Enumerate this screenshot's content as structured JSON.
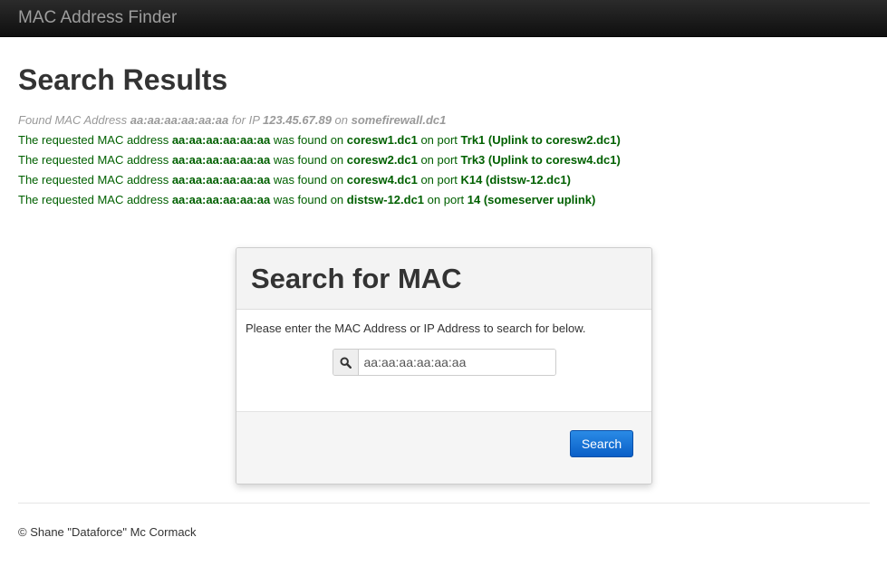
{
  "navbar": {
    "brand": "MAC Address Finder"
  },
  "results": {
    "title": "Search Results",
    "summary": {
      "prefix": "Found MAC Address ",
      "mac": "aa:aa:aa:aa:aa:aa",
      "for_ip": " for IP ",
      "ip": "123.45.67.89",
      "on": " on ",
      "device": "somefirewall.dc1"
    },
    "lines": [
      {
        "prefix": "The requested MAC address ",
        "mac": "aa:aa:aa:aa:aa:aa",
        "found_on": " was found on ",
        "switch": "coresw1.dc1",
        "on_port": " on port ",
        "port": "Trk1 (Uplink to coresw2.dc1)"
      },
      {
        "prefix": "The requested MAC address ",
        "mac": "aa:aa:aa:aa:aa:aa",
        "found_on": " was found on ",
        "switch": "coresw2.dc1",
        "on_port": " on port ",
        "port": "Trk3 (Uplink to coresw4.dc1)"
      },
      {
        "prefix": "The requested MAC address ",
        "mac": "aa:aa:aa:aa:aa:aa",
        "found_on": " was found on ",
        "switch": "coresw4.dc1",
        "on_port": " on port ",
        "port": "K14 (distsw-12.dc1)"
      },
      {
        "prefix": "The requested MAC address ",
        "mac": "aa:aa:aa:aa:aa:aa",
        "found_on": " was found on ",
        "switch": "distsw-12.dc1",
        "on_port": " on port ",
        "port": "14 (someserver uplink)"
      }
    ]
  },
  "search_panel": {
    "title": "Search for MAC",
    "hint": "Please enter the MAC Address or IP Address to search for below.",
    "input_value": "aa:aa:aa:aa:aa:aa",
    "search_icon": "search-icon",
    "button_label": "Search"
  },
  "footer": {
    "text": "© Shane \"Dataforce\" Mc Cormack"
  },
  "colors": {
    "success": "#006000",
    "muted": "#999999",
    "button": "#0a5fc7"
  }
}
